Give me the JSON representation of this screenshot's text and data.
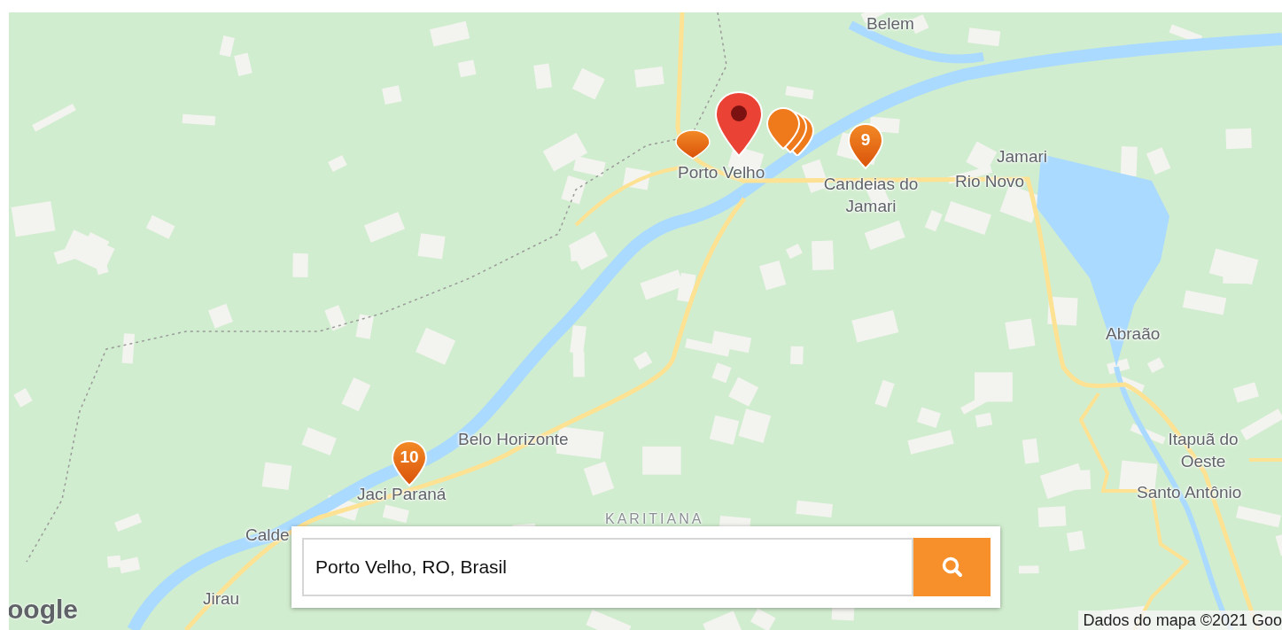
{
  "map": {
    "labels": [
      {
        "kind": "place",
        "text": "Belem"
      },
      {
        "kind": "place",
        "text": "Porto Velho"
      },
      {
        "kind": "place",
        "text": "Candeias do Jamari"
      },
      {
        "kind": "place",
        "text": "Jamari"
      },
      {
        "kind": "place",
        "text": "Rio Novo"
      },
      {
        "kind": "place",
        "text": "Abraão"
      },
      {
        "kind": "place",
        "text": "Belo Horizonte"
      },
      {
        "kind": "place",
        "text": "Jaci Paraná"
      },
      {
        "kind": "region",
        "text": "KARITIANA"
      },
      {
        "kind": "place",
        "text": "Calde"
      },
      {
        "kind": "place",
        "text": "Jirau"
      },
      {
        "kind": "place",
        "text": "Itapuã do Oeste"
      },
      {
        "kind": "place",
        "text": "Santo Antônio"
      }
    ],
    "markers": [
      {
        "kind": "cluster"
      },
      {
        "kind": "pin"
      },
      {
        "kind": "primary"
      },
      {
        "kind": "numbered",
        "label": "9"
      },
      {
        "kind": "numbered",
        "label": "10"
      }
    ],
    "logo": "oogle",
    "attribution": "Dados do mapa ©2021 Goo"
  },
  "search": {
    "value": "Porto Velho, RO, Brasil"
  }
}
